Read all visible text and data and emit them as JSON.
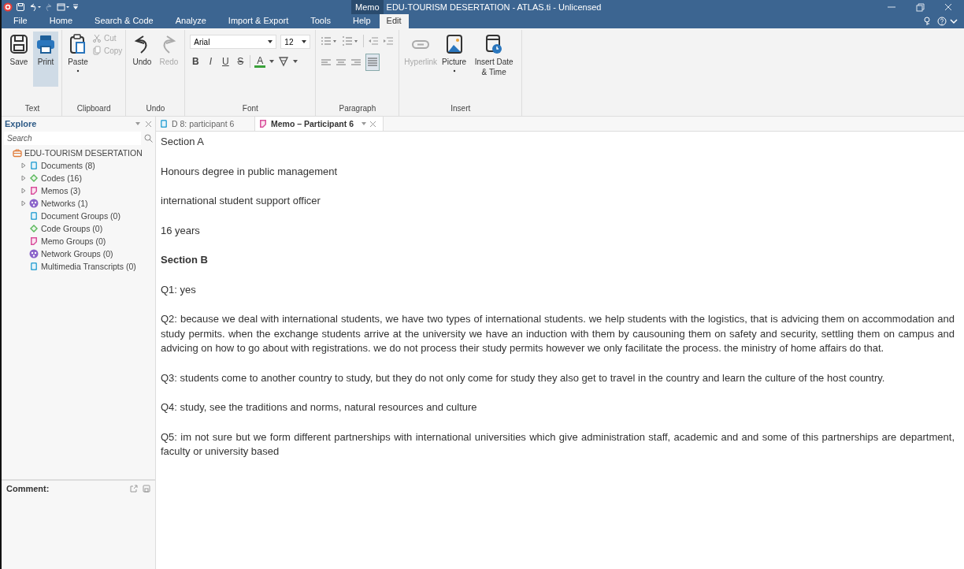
{
  "window": {
    "context_tab": "Memo",
    "title": "EDU-TOURISM DESERTATION - ATLAS.ti - Unlicensed"
  },
  "menu_tabs": [
    {
      "label": "File",
      "selected": false
    },
    {
      "label": "Home",
      "selected": false
    },
    {
      "label": "Search & Code",
      "selected": false
    },
    {
      "label": "Analyze",
      "selected": false
    },
    {
      "label": "Import & Export",
      "selected": false
    },
    {
      "label": "Tools",
      "selected": false
    },
    {
      "label": "Help",
      "selected": false
    },
    {
      "label": "Edit",
      "selected": true
    }
  ],
  "ribbon": {
    "groups": [
      {
        "title": "Text",
        "buttons": [
          {
            "label": "Save",
            "pressed": false,
            "disabled": false
          },
          {
            "label": "Print",
            "pressed": true,
            "disabled": false
          }
        ]
      },
      {
        "title": "Clipboard",
        "buttons": [
          {
            "label": "Paste",
            "pressed": false,
            "disabled": false
          }
        ],
        "small_buttons": [
          {
            "label": "Cut",
            "disabled": true
          },
          {
            "label": "Copy",
            "disabled": true
          }
        ]
      },
      {
        "title": "Undo",
        "buttons": [
          {
            "label": "Undo",
            "pressed": false,
            "disabled": false
          },
          {
            "label": "Redo",
            "pressed": false,
            "disabled": true
          }
        ]
      },
      {
        "title": "Font",
        "font_name": "Arial",
        "font_size": "12",
        "format_buttons": [
          "B",
          "I",
          "U",
          "S"
        ],
        "color_button": "A"
      },
      {
        "title": "Paragraph"
      },
      {
        "title": "Insert",
        "buttons": [
          {
            "label": "Hyperlink",
            "pressed": false,
            "disabled": true
          },
          {
            "label": "Picture",
            "pressed": false,
            "disabled": false
          },
          {
            "label": "Insert Date & Time",
            "pressed": false,
            "disabled": false
          }
        ]
      }
    ]
  },
  "explore": {
    "title": "Explore",
    "search": {
      "placeholder": "Search"
    },
    "tree": [
      {
        "label": "EDU-TOURISM DESERTATION",
        "kind": "project",
        "color": "#e07b39",
        "children": [
          {
            "label": "Documents (8)",
            "kind": "document",
            "color": "#3fa9d6",
            "expanded": false
          },
          {
            "label": "Codes (16)",
            "kind": "code",
            "color": "#5cb85c",
            "expanded": false
          },
          {
            "label": "Memos (3)",
            "kind": "memo",
            "color": "#d94f9c",
            "expanded": false
          },
          {
            "label": "Networks (1)",
            "kind": "network",
            "color": "#8a63c9",
            "expanded": false
          },
          {
            "label": "Document Groups (0)",
            "kind": "document",
            "color": "#3fa9d6"
          },
          {
            "label": "Code Groups (0)",
            "kind": "code",
            "color": "#5cb85c"
          },
          {
            "label": "Memo Groups (0)",
            "kind": "memo",
            "color": "#d94f9c"
          },
          {
            "label": "Network Groups (0)",
            "kind": "network",
            "color": "#8a63c9"
          },
          {
            "label": "Multimedia Transcripts (0)",
            "kind": "document",
            "color": "#3fa9d6"
          }
        ]
      }
    ]
  },
  "comment": {
    "label": "Comment:"
  },
  "doc_tabs": [
    {
      "label": "D 8: participant 6",
      "kind": "document",
      "selected": false
    },
    {
      "label": "Memo – Participant 6",
      "kind": "memo",
      "selected": true
    }
  ],
  "memo_paragraphs": [
    {
      "text": "Section A",
      "bold": false
    },
    {
      "text": "Honours degree in public management",
      "bold": false
    },
    {
      "text": "international student support officer",
      "bold": false
    },
    {
      "text": "16 years",
      "bold": false
    },
    {
      "text": "Section B",
      "bold": true
    },
    {
      "text": "Q1: yes",
      "bold": false
    },
    {
      "text": "Q2: because we deal with international students, we have two types of international students. we help students with the logistics, that is advicing them on accommodation and study permits. when the exchange students arrive at the university we have an induction with them by causouning them on safety and security, settling them on campus and advicing on how to go about with registrations. we do not process their study permits however we only facilitate the process. the ministry of home affairs do that.",
      "bold": false
    },
    {
      "text": "Q3: students come to another country to study, but they do not only come for study they also get to travel in the country and learn the culture of the host country.",
      "bold": false
    },
    {
      "text": "Q4: study, see the traditions and norms, natural resources and culture",
      "bold": false
    },
    {
      "text": "Q5: im not sure but we form different partnerships with international universities which give administration staff, academic and  and some of this partnerships are department, faculty or university based",
      "bold": false
    }
  ]
}
